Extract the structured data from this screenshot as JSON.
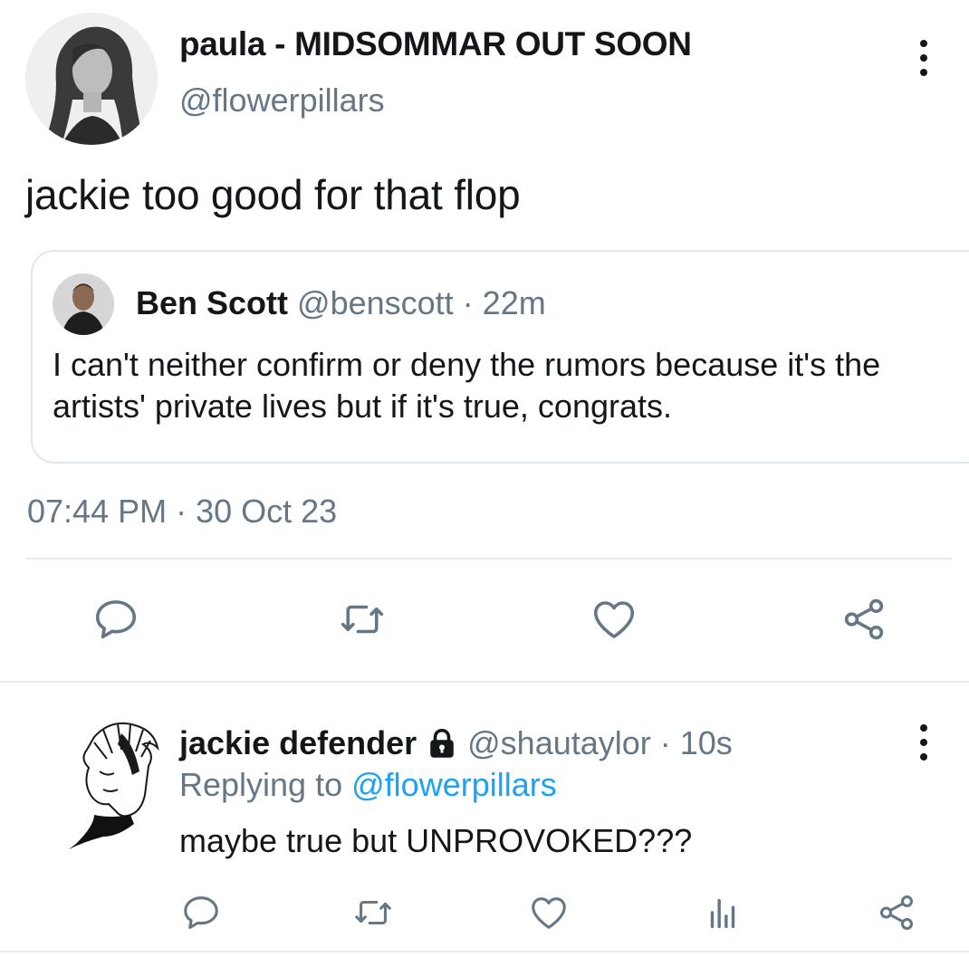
{
  "main_tweet": {
    "display_name": "paula - MIDSOMMAR OUT SOON",
    "handle": "@flowerpillars",
    "text": "jackie too good for that flop",
    "timestamp": "07:44 PM · 30 Oct 23",
    "more_icon": "more-vertical-icon"
  },
  "quoted_tweet": {
    "display_name": "Ben Scott",
    "handle": "@benscott",
    "time": "· 22m",
    "text": "I can't neither confirm or deny the rumors because it's the artists' private lives but if it's true, congrats."
  },
  "main_actions": [
    {
      "icon": "reply-icon"
    },
    {
      "icon": "retweet-icon"
    },
    {
      "icon": "like-icon"
    },
    {
      "icon": "share-icon"
    }
  ],
  "reply_tweet": {
    "display_name": "jackie defender",
    "protected_icon": "lock-icon",
    "handle": "@shautaylor",
    "time": "· 10s",
    "replying_prefix": "Replying to",
    "replying_to": "@flowerpillars",
    "text": "maybe true but UNPROVOKED???",
    "more_icon": "more-vertical-icon"
  },
  "reply_actions": [
    {
      "icon": "reply-icon"
    },
    {
      "icon": "retweet-icon"
    },
    {
      "icon": "like-icon"
    },
    {
      "icon": "analytics-icon"
    },
    {
      "icon": "share-icon"
    }
  ],
  "colors": {
    "text": "#14171a",
    "secondary": "#657786",
    "link": "#1da1f2",
    "divider": "#e6ecf0",
    "icon": "#657786"
  }
}
